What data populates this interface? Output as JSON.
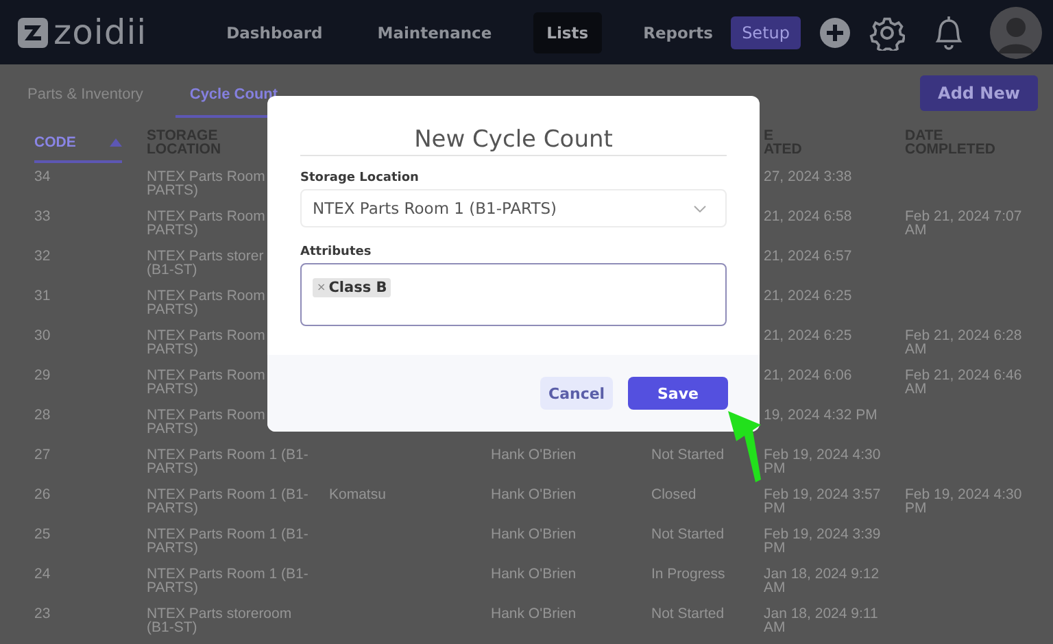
{
  "nav": {
    "logo": "zoidii",
    "items": [
      {
        "label": "Dashboard",
        "selected": false
      },
      {
        "label": "Maintenance",
        "selected": false
      },
      {
        "label": "Lists",
        "selected": true
      },
      {
        "label": "Reports",
        "selected": false
      }
    ],
    "setup_button": "Setup"
  },
  "tabs": [
    {
      "label": "Parts & Inventory",
      "selected": false
    },
    {
      "label": "Cycle Count",
      "selected": true
    }
  ],
  "add_button": "Add New",
  "table": {
    "columns": [
      {
        "label": "CODE",
        "sorted": true
      },
      {
        "label": "STORAGE LOCATION"
      },
      {},
      {},
      {},
      {
        "label": "E ATED"
      },
      {
        "label": "DATE COMPLETED"
      }
    ],
    "rows": [
      [
        "34",
        "NTEX Parts Room\nPARTS)",
        null,
        null,
        null,
        "27, 2024 3:38",
        null
      ],
      [
        "33",
        "NTEX Parts Room\nPARTS)",
        null,
        null,
        null,
        "21, 2024 6:58",
        "Feb 21, 2024 7:07 AM"
      ],
      [
        "32",
        "NTEX Parts storer\n(B1-ST)",
        null,
        null,
        null,
        "21, 2024 6:57",
        null
      ],
      [
        "31",
        "NTEX Parts Room\nPARTS)",
        null,
        null,
        null,
        "21, 2024 6:25",
        null
      ],
      [
        "30",
        "NTEX Parts Room\nPARTS)",
        null,
        null,
        null,
        "21, 2024 6:25",
        "Feb 21, 2024 6:28 AM"
      ],
      [
        "29",
        "NTEX Parts Room\nPARTS)",
        null,
        null,
        null,
        "21, 2024 6:06",
        "Feb 21, 2024 6:46 AM"
      ],
      [
        "28",
        "NTEX Parts Room\nPARTS)",
        null,
        null,
        null,
        "19, 2024 4:32 PM",
        null
      ],
      [
        "27",
        "NTEX Parts Room 1 (B1-PARTS)",
        null,
        "Hank O'Brien",
        "Not Started",
        "Feb 19, 2024 4:30 PM",
        null
      ],
      [
        "26",
        "NTEX Parts Room 1 (B1-PARTS)",
        "Komatsu",
        "Hank O'Brien",
        "Closed",
        "Feb 19, 2024 3:57 PM",
        "Feb 19, 2024 4:30 PM"
      ],
      [
        "25",
        "NTEX Parts Room 1 (B1-PARTS)",
        null,
        "Hank O'Brien",
        "Not Started",
        "Feb 19, 2024 3:39 PM",
        null
      ],
      [
        "24",
        "NTEX Parts Room 1 (B1-PARTS)",
        null,
        "Hank O'Brien",
        "In Progress",
        "Jan 18, 2024 9:12 AM",
        null
      ],
      [
        "23",
        "NTEX Parts storeroom (B1-ST)",
        null,
        "Hank O'Brien",
        "Not Started",
        "Jan 18, 2024 9:11 AM",
        null
      ]
    ]
  },
  "modal": {
    "title": "New Cycle Count",
    "fields": [
      {
        "kind": "select",
        "label": "Storage Location",
        "value": "NTEX Parts Room 1 (B1-PARTS)"
      },
      {
        "kind": "tags",
        "label": "Attributes",
        "tags": [
          {
            "remove": "×",
            "label": "Class B"
          }
        ]
      }
    ],
    "buttons": [
      {
        "kind": "secondary",
        "label": "Cancel"
      },
      {
        "kind": "primary",
        "label": "Save"
      }
    ]
  }
}
